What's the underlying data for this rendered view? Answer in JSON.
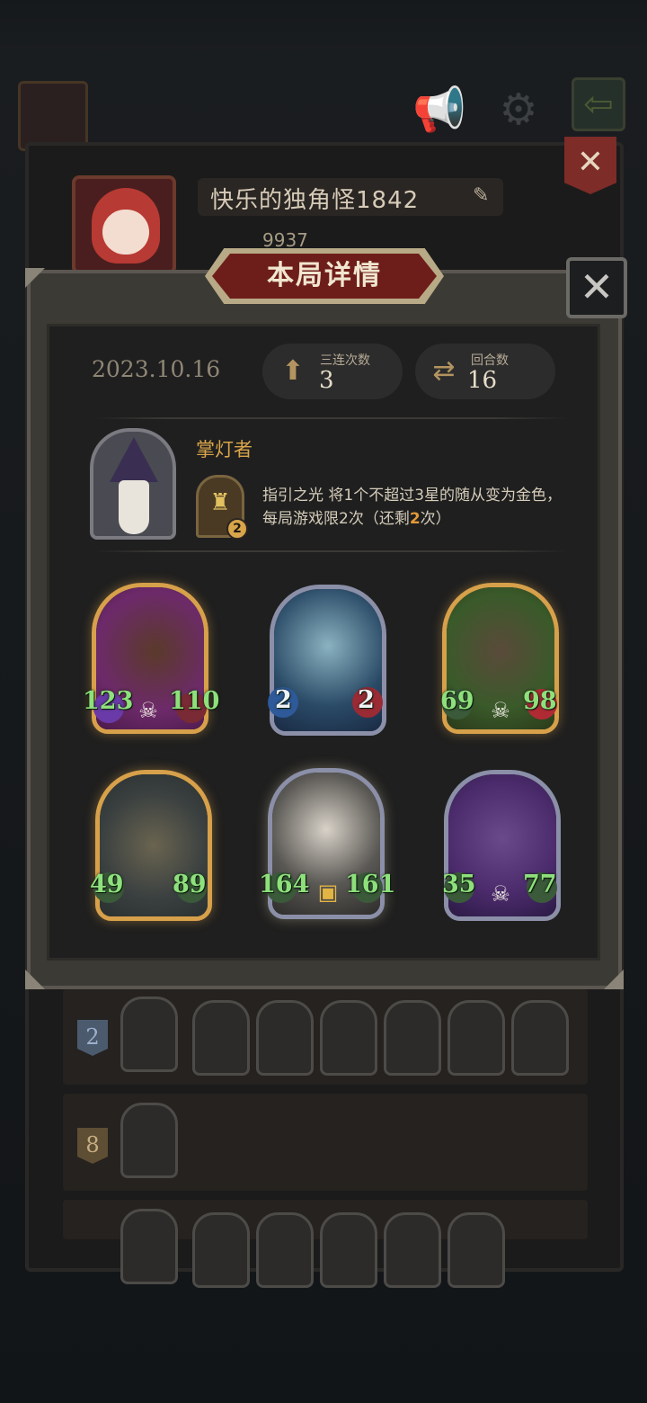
{
  "profile": {
    "name": "快乐的独角怪1842",
    "score": "9937"
  },
  "modal": {
    "title": "本局详情",
    "date": "2023.10.16",
    "stats": {
      "triples_label": "三连次数",
      "triples_value": "3",
      "rounds_label": "回合数",
      "rounds_value": "16"
    },
    "hero": {
      "name": "掌灯者",
      "skill_badge": "2",
      "skill_name": "指引之光",
      "skill_text_1": " 将",
      "skill_n1": "1",
      "skill_text_2": "个不超过",
      "skill_n2": "3",
      "skill_text_3": "星的随从变为金色，每局游戏限",
      "skill_n3": "2",
      "skill_text_4": "次（还剩",
      "skill_n4": "2",
      "skill_text_5": "次）"
    },
    "minions": [
      {
        "attack": "123",
        "health": "110",
        "frame": "gold",
        "skull": true
      },
      {
        "attack": "2",
        "health": "2",
        "frame": "silver",
        "skull": false
      },
      {
        "attack": "69",
        "health": "98",
        "frame": "gold",
        "skull": true
      },
      {
        "attack": "49",
        "health": "89",
        "frame": "gold",
        "skull": false
      },
      {
        "attack": "164",
        "health": "161",
        "frame": "silver",
        "skull": false
      },
      {
        "attack": "35",
        "health": "77",
        "frame": "silver",
        "skull": true
      }
    ]
  },
  "history": [
    {
      "rank": "2"
    },
    {
      "rank": "8"
    }
  ],
  "colors": {
    "gold_text": "#d9a54a",
    "stat_green": "#8ee07c",
    "highlight": "#e29a38"
  }
}
